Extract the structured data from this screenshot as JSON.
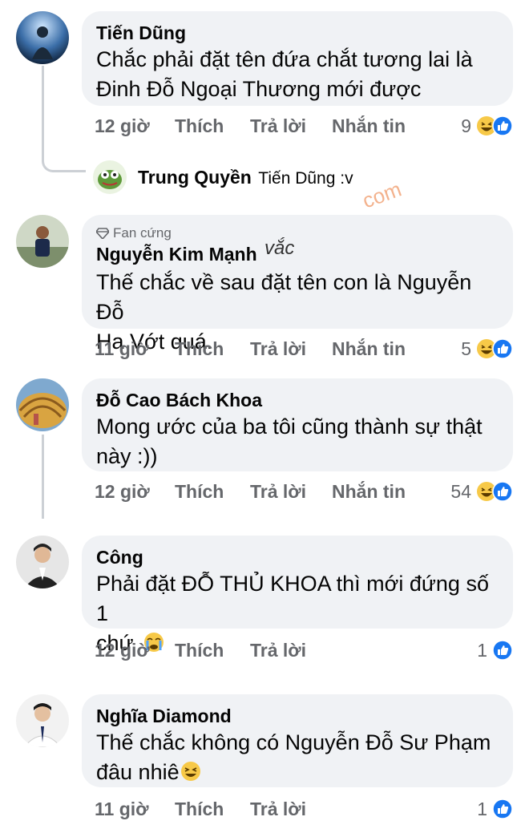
{
  "comments": [
    {
      "author": "Tiến Dũng",
      "text_line1": "Chắc phải đặt tên đứa chắt tương lai là",
      "text_line2": "Đinh Đỗ Ngoại Thương mới được",
      "time": "12 giờ",
      "reaction_count": "9"
    },
    {
      "reply_author": "Trung Quyền",
      "reply_text": "Tiến Dũng :v"
    },
    {
      "badge": "Fan cứng",
      "author": "Nguyễn Kim Mạnh",
      "handwritten_overlay": "vắc",
      "text_line1": "Thế chắc về sau đặt tên con là Nguyễn Đỗ",
      "text_line2": "Ha Vớt quá.",
      "time": "11 giờ",
      "reaction_count": "5"
    },
    {
      "author": "Đỗ Cao Bách Khoa",
      "text_line1": "Mong ước của ba tôi cũng thành sự thật",
      "text_line2": "này :))",
      "time": "12 giờ",
      "reaction_count": "54"
    },
    {
      "author": "Công",
      "text_line1": "Phải đặt ĐỖ THỦ KHOA thì mới đứng số 1",
      "text_line2": "chứ",
      "time": "12 giờ",
      "reaction_count": "1"
    },
    {
      "author": "Nghĩa Diamond",
      "text_line1": "Thế chắc không có Nguyễn Đỗ Sư Phạm",
      "text_line2": "đâu nhiê",
      "time": "11 giờ",
      "reaction_count": "1"
    }
  ],
  "actions": {
    "like": "Thích",
    "reply": "Trả lời",
    "message": "Nhắn tin"
  },
  "watermark": "com",
  "colors": {
    "bubble": "#f0f2f5",
    "meta_text": "#65676b",
    "like_blue": "#1877f2",
    "haha_yellow": "#f7c948"
  }
}
